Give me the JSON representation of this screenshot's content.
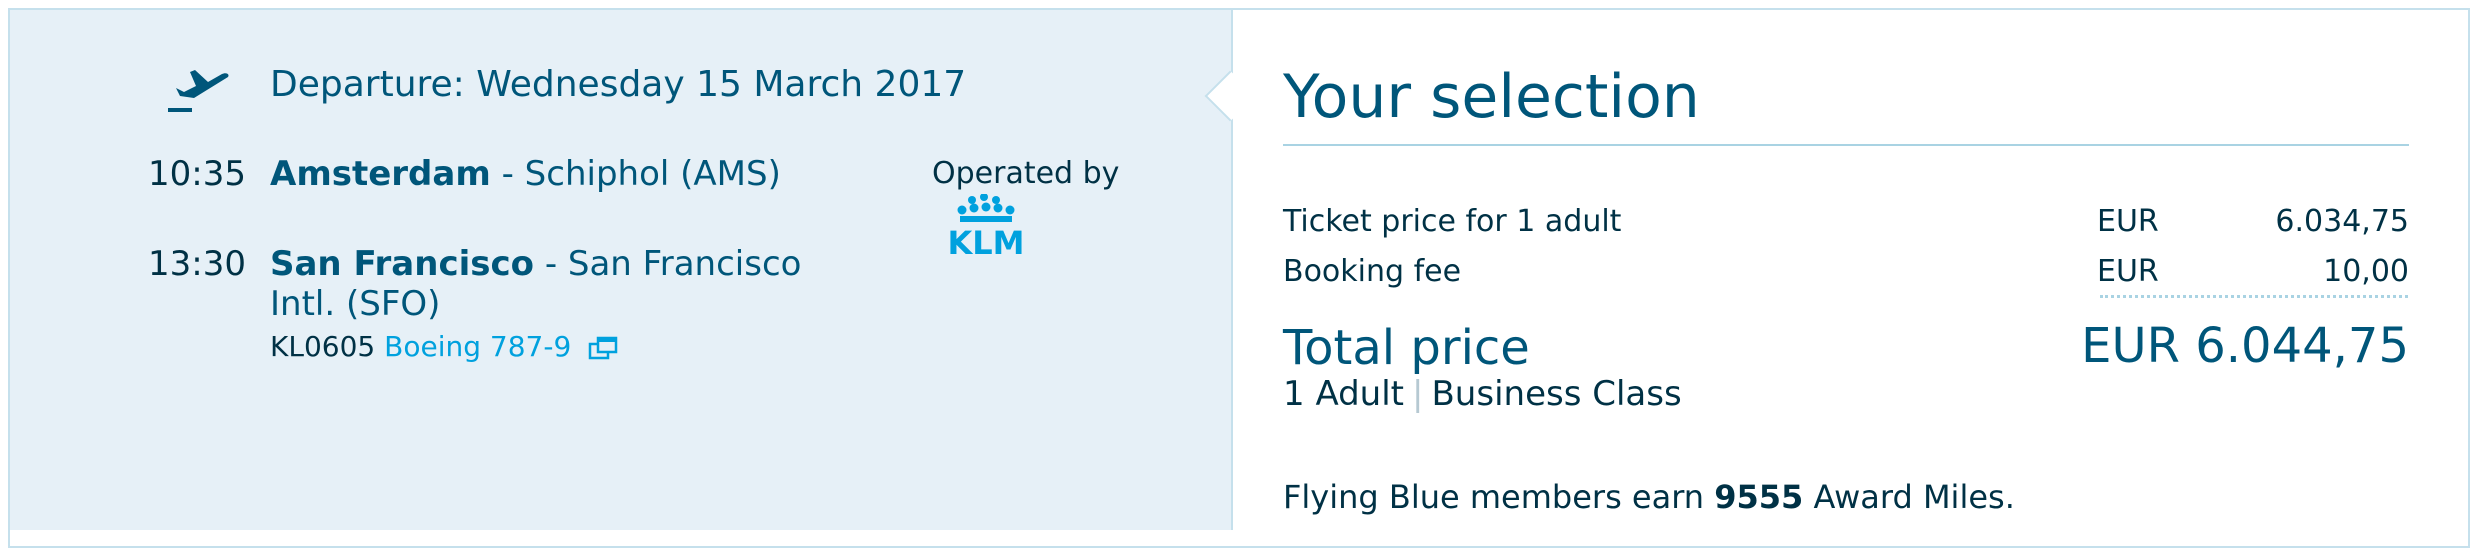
{
  "departure": {
    "title": "Departure: Wednesday 15 March 2017",
    "origin": {
      "time": "10:35",
      "city": "Amsterdam",
      "airport": "- Schiphol (AMS)"
    },
    "destination": {
      "time": "13:30",
      "city": "San Francisco",
      "airport_line1": "- San Francisco",
      "airport_line2": "Intl. (SFO)"
    },
    "flight_number": "KL0605",
    "aircraft": "Boeing 787-9",
    "operated_by_label": "Operated by",
    "carrier_logo_text": "KLM"
  },
  "selection": {
    "title": "Your selection",
    "rows": [
      {
        "label": "Ticket price for 1 adult",
        "currency": "EUR",
        "amount": "6.034,75"
      },
      {
        "label": "Booking fee",
        "currency": "EUR",
        "amount": "10,00"
      }
    ],
    "total_label": "Total price",
    "total_amount": "EUR 6.044,75",
    "pax": "1 Adult",
    "separator": "|",
    "cabin": "Business Class",
    "miles_prefix": "Flying Blue members earn",
    "miles_value": "9555",
    "miles_suffix": "Award Miles."
  },
  "colors": {
    "accent": "#00567a",
    "link": "#00a1de",
    "panel_bg": "#e6f0f7",
    "border": "#c5e0ec"
  },
  "icons": [
    "plane-takeoff-icon",
    "external-window-icon",
    "klm-logo"
  ]
}
